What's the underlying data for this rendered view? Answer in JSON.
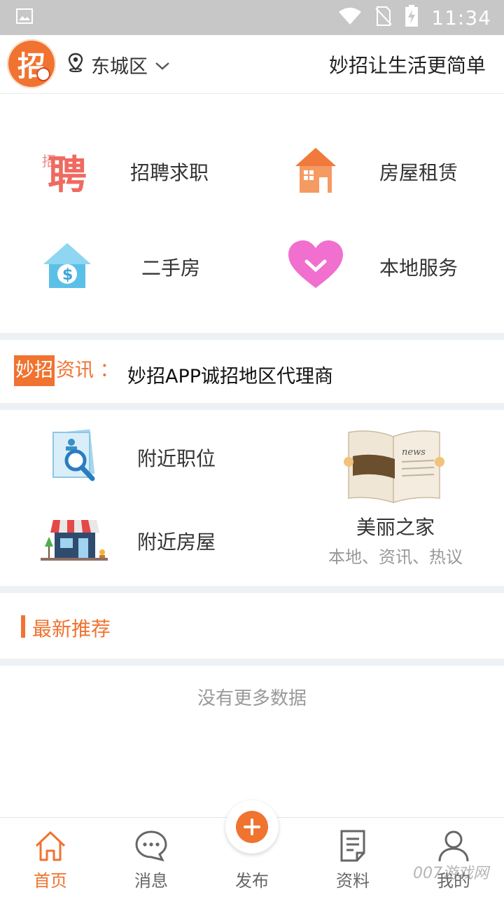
{
  "status_bar": {
    "time": "11:34"
  },
  "header": {
    "logo_char": "招",
    "location": "东城区",
    "slogan": "妙招让生活更简单"
  },
  "categories": [
    {
      "label": "招聘求职",
      "icon": "recruit-icon"
    },
    {
      "label": "房屋租赁",
      "icon": "house-icon"
    },
    {
      "label": "二手房",
      "icon": "dollar-house-icon"
    },
    {
      "label": "本地服务",
      "icon": "heart-icon"
    }
  ],
  "ticker": {
    "tag_strong": "妙招",
    "tag_rest": "资讯 ：",
    "text": "妙招APP诚招地区代理商"
  },
  "nearby": {
    "jobs_label": "附近职位",
    "houses_label": "附近房屋",
    "beauty_title": "美丽之家",
    "beauty_sub": "本地、资讯、热议",
    "news_word": "news"
  },
  "latest": {
    "title": "最新推荐",
    "empty": "没有更多数据"
  },
  "bottom_nav": {
    "items": [
      {
        "label": "首页",
        "icon": "home-icon"
      },
      {
        "label": "消息",
        "icon": "message-icon"
      },
      {
        "label": "发布",
        "icon": "plus-icon"
      },
      {
        "label": "资料",
        "icon": "document-icon"
      },
      {
        "label": "我的",
        "icon": "user-icon"
      }
    ]
  },
  "watermark": "007游戏网",
  "colors": {
    "accent": "#f07330",
    "divider": "#eef1f4"
  }
}
